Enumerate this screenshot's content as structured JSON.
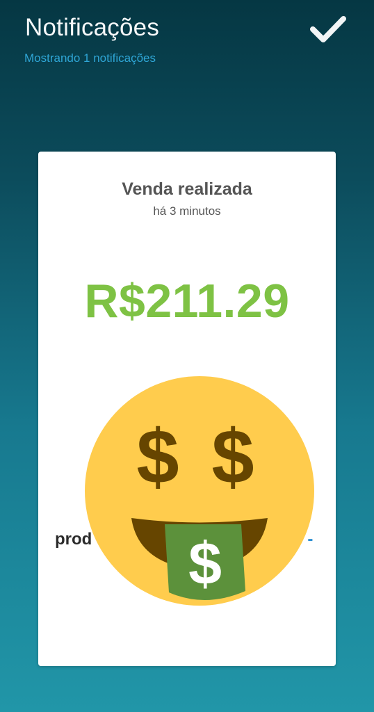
{
  "header": {
    "title": "Notificações",
    "subtitle": "Mostrando 1 notificações"
  },
  "icons": {
    "confirm": "check-icon",
    "emoji": "money-mouth-face-emoji"
  },
  "notification": {
    "title": "Venda realizada",
    "time": "há 3 minutos",
    "amount": "R$211.29",
    "product_left_fragment": "prod",
    "product_right_fragment": "o -"
  },
  "colors": {
    "background_top": "#053743",
    "background_bottom": "#2196a8",
    "subtitle": "#2fa6d6",
    "amount": "#7ec244",
    "product_link": "#2c8fd2",
    "emoji_face": "#ffcc4d",
    "emoji_features": "#664500",
    "emoji_tongue": "#5c913b"
  }
}
